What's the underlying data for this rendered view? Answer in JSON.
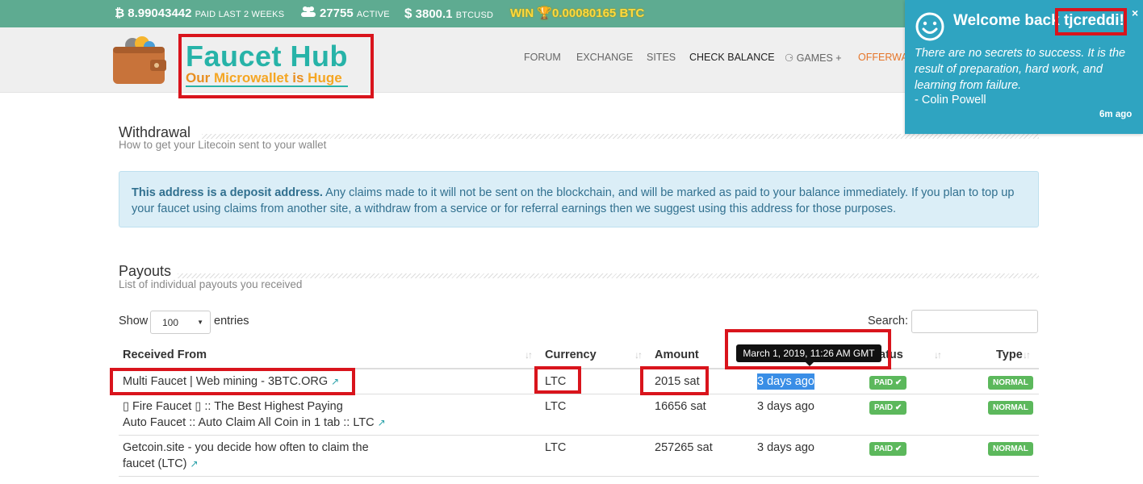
{
  "topbar": {
    "paid_icon": "₿",
    "paid_amount": "8.99043442",
    "paid_label": "PAID LAST 2 WEEKS",
    "users_icon": "users-icon",
    "active_count": "27755",
    "active_label": "ACTIVE",
    "dollar_sign": "$",
    "price": "3800.1",
    "price_label": "BTCUSD",
    "win_label": "WIN",
    "win_amount": "0.00080165 BTC"
  },
  "header": {
    "logo_title": "Faucet Hub",
    "logo_sub_1": "Our ",
    "logo_sub_2": "Microwallet",
    "logo_sub_3": " is ",
    "logo_sub_4": "Huge",
    "nav": [
      "FORUM",
      "EXCHANGE",
      "SITES",
      "CHECK BALANCE",
      "GAMES +",
      "OFFERWA"
    ]
  },
  "withdrawal": {
    "title": "Withdrawal",
    "subtitle": "How to get your Litecoin sent to your wallet",
    "alert_bold": "This address is a deposit address.",
    "alert_text_1": " Any claims made to it will not be sent on the blockchain, and will be marked as paid to your balance immediately. If you plan to top up",
    "alert_text_2": "your faucet using claims from another site, a withdraw from a service or for referral earnings then we suggest using this address for those purposes."
  },
  "payouts": {
    "title": "Payouts",
    "subtitle": "List of individual payouts you received",
    "show_label": "Show",
    "entries_value": "100",
    "entries_label": "entries",
    "search_label": "Search:",
    "columns": [
      "Received From",
      "Currency",
      "Amount",
      "Status",
      "Type"
    ],
    "status_col_visible": "atus",
    "tooltip": "March 1, 2019, 11:26 AM GMT",
    "rows": [
      {
        "from_1": "Multi Faucet | Web mining - 3BTC.ORG",
        "from_2": "",
        "currency": "LTC",
        "amount": "2015 sat",
        "time": "3 days ago",
        "status": "PAID ✔",
        "type": "NORMAL"
      },
      {
        "from_1": "▯ Fire Faucet ▯ :: The Best Highest Paying",
        "from_2": "Auto Faucet :: Auto Claim All Coin in 1 tab :: LTC",
        "currency": "LTC",
        "amount": "16656 sat",
        "time": "3 days ago",
        "status": "PAID ✔",
        "type": "NORMAL"
      },
      {
        "from_1": "Getcoin.site - you decide how often to claim the",
        "from_2": "faucet (LTC)",
        "currency": "LTC",
        "amount": "257265 sat",
        "time": "3 days ago",
        "status": "PAID ✔",
        "type": "NORMAL"
      }
    ]
  },
  "notification": {
    "title_prefix": "Welcome back ",
    "username": "tjcreddi!",
    "close": "×",
    "quote": "There are no secrets to success. It is the result of preparation, hard work, and learning from failure.",
    "author": "- Colin Powell",
    "time": "6m ago"
  },
  "colors": {
    "topbar": "#5eab91",
    "accent": "#27b3a8",
    "notif": "#2fa4c1",
    "badge": "#5cb85c",
    "highlight": "#d9141c"
  }
}
